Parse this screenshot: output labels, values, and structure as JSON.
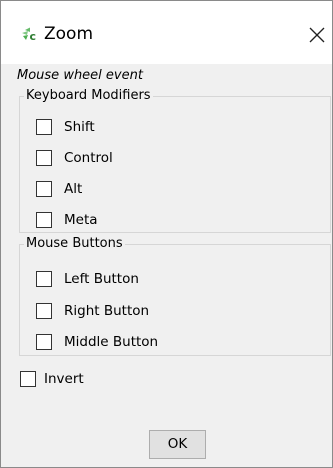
{
  "window": {
    "title": "Zoom",
    "icons": {
      "app": "zoom-app-icon",
      "close": "close-icon"
    }
  },
  "caption": "Mouse wheel event",
  "keyboard_modifiers": {
    "legend": "Keyboard Modifiers",
    "items": [
      {
        "label": "Shift",
        "checked": false
      },
      {
        "label": "Control",
        "checked": false
      },
      {
        "label": "Alt",
        "checked": false
      },
      {
        "label": "Meta",
        "checked": false
      }
    ]
  },
  "mouse_buttons": {
    "legend": "Mouse Buttons",
    "items": [
      {
        "label": "Left Button",
        "checked": false
      },
      {
        "label": "Right Button",
        "checked": false
      },
      {
        "label": "Middle Button",
        "checked": false
      }
    ]
  },
  "invert": {
    "label": "Invert",
    "checked": false
  },
  "ok_label": "OK",
  "colors": {
    "icon_green": "#4caf50",
    "icon_dark": "#2e7d32",
    "dialog_bg": "#f0f0f0",
    "title_bg": "#ffffff"
  }
}
